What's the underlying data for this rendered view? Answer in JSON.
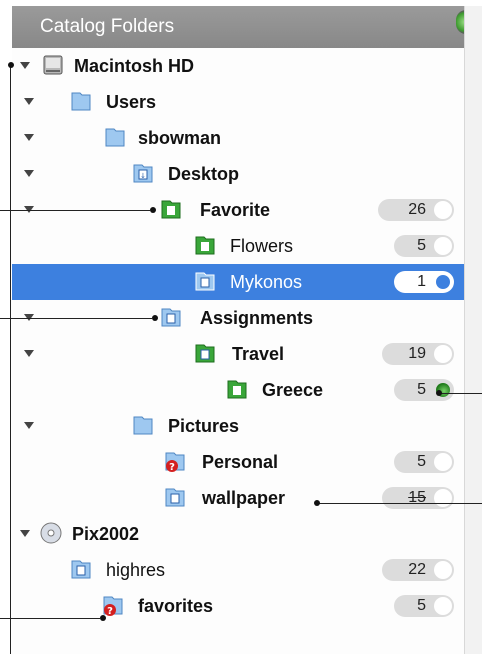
{
  "panel": {
    "title": "Catalog Folders"
  },
  "rows": [
    {
      "label": "Macintosh HD",
      "count": null
    },
    {
      "label": "Users",
      "count": null
    },
    {
      "label": "sbowman",
      "count": null
    },
    {
      "label": "Desktop",
      "count": null
    },
    {
      "label": "Favorite",
      "count": "26"
    },
    {
      "label": "Flowers",
      "count": "5"
    },
    {
      "label": "Mykonos",
      "count": "1"
    },
    {
      "label": "Assignments",
      "count": null
    },
    {
      "label": "Travel",
      "count": "19"
    },
    {
      "label": "Greece",
      "count": "5"
    },
    {
      "label": "Pictures",
      "count": null
    },
    {
      "label": "Personal",
      "count": "5"
    },
    {
      "label": "wallpaper",
      "count": "15"
    },
    {
      "label": "Pix2002",
      "count": null
    },
    {
      "label": "highres",
      "count": "22"
    },
    {
      "label": "favorites",
      "count": "5"
    }
  ],
  "colors": {
    "selection": "#3d80df",
    "header": "#8f8f8f",
    "folder_blue": "#7fb2e8",
    "folder_green": "#3aa63a",
    "warning_red": "#d42020"
  },
  "icons": {
    "disk": "hard-disk-icon",
    "folder": "folder-icon",
    "folder_blue_badge": "folder-badge-icon",
    "folder_green": "green-folder-icon",
    "warning_folder": "warning-folder-icon",
    "cd": "cd-icon"
  }
}
